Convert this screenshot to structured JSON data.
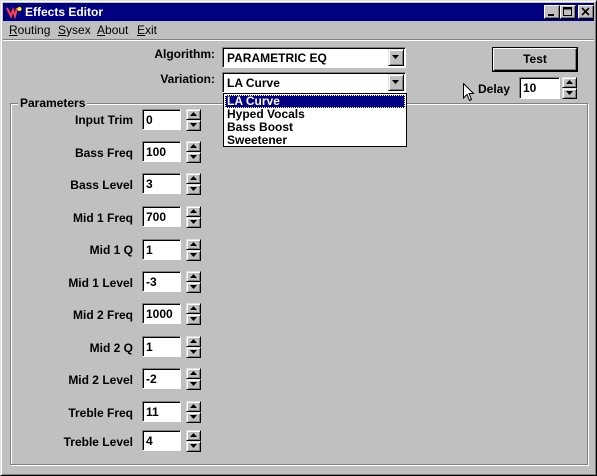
{
  "window": {
    "title": "Effects Editor",
    "colors": {
      "titlebar": "#000080",
      "face": "#c0c0c0",
      "selection": "#000080"
    }
  },
  "menu": [
    {
      "label": "Routing",
      "underline": "R",
      "rest": "outing"
    },
    {
      "label": "Sysex",
      "underline": "S",
      "rest": "ysex"
    },
    {
      "label": "About",
      "underline": "A",
      "rest": "bout"
    },
    {
      "label": "Exit",
      "underline": "E",
      "rest": "xit"
    }
  ],
  "algorithm": {
    "label": "Algorithm:",
    "value": "PARAMETRIC EQ"
  },
  "variation": {
    "label": "Variation:",
    "value": "LA Curve",
    "options": [
      "LA Curve",
      "Hyped Vocals",
      "Bass Boost",
      "Sweetener"
    ],
    "selected_index": 0
  },
  "test_button": "Test",
  "delay": {
    "label": "Delay",
    "value": "10"
  },
  "parameters": {
    "title": "Parameters",
    "rows": [
      {
        "label": "Input Trim",
        "value": "0"
      },
      {
        "label": "Bass Freq",
        "value": "100"
      },
      {
        "label": "Bass Level",
        "value": "3"
      },
      {
        "label": "Mid 1 Freq",
        "value": "700"
      },
      {
        "label": "Mid 1 Q",
        "value": "1"
      },
      {
        "label": "Mid 1 Level",
        "value": "-3"
      },
      {
        "label": "Mid 2 Freq",
        "value": "1000"
      },
      {
        "label": "Mid 2 Q",
        "value": "1"
      },
      {
        "label": "Mid 2 Level",
        "value": "-2"
      },
      {
        "label": "Treble Freq",
        "value": "11"
      },
      {
        "label": "Treble Level",
        "value": "4"
      }
    ]
  },
  "icons": {
    "app": "effects-app-icon",
    "minimize": "minimize-icon",
    "maximize": "maximize-icon",
    "close": "close-icon",
    "dropdown": "chevron-down-icon",
    "spin_up": "spin-up-icon",
    "spin_down": "spin-down-icon",
    "cursor": "mouse-pointer-icon"
  }
}
